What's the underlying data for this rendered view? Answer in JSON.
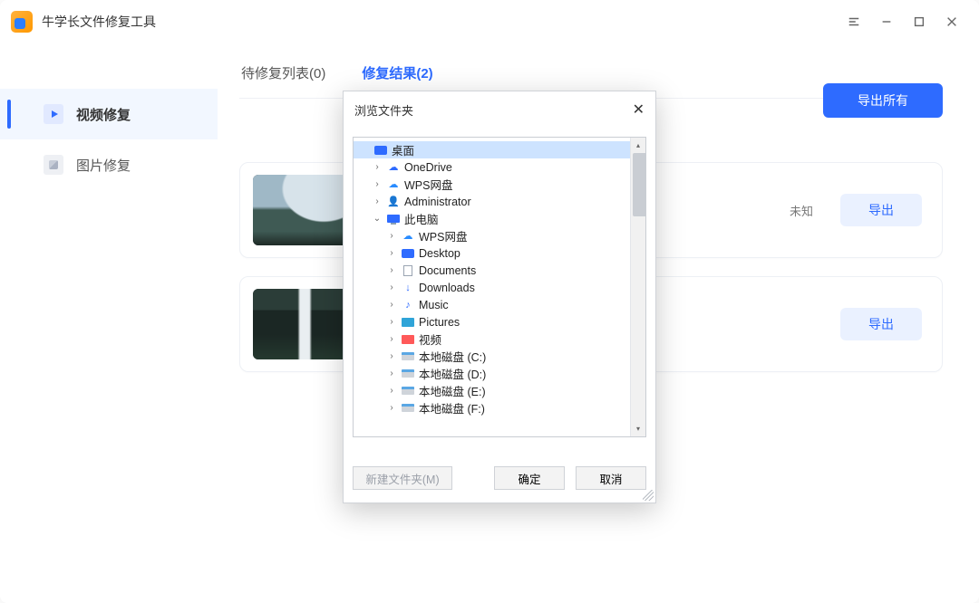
{
  "app": {
    "title": "牛学长文件修复工具"
  },
  "sidebar": {
    "items": [
      {
        "label": "视频修复"
      },
      {
        "label": "图片修复"
      }
    ]
  },
  "tabs": {
    "pending": "待修复列表(0)",
    "results": "修复结果(2)"
  },
  "buttons": {
    "export_all": "导出所有",
    "export_one": "导出"
  },
  "cards": [
    {
      "meta_visible": "未知"
    },
    {
      "meta_visible": ""
    }
  ],
  "dialog": {
    "title": "浏览文件夹",
    "new_folder": "新建文件夹(M)",
    "ok": "确定",
    "cancel": "取消",
    "tree": {
      "desktop": "桌面",
      "onedrive": "OneDrive",
      "wps": "WPS网盘",
      "admin": "Administrator",
      "thispc": "此电脑",
      "wps2": "WPS网盘",
      "desktop2": "Desktop",
      "documents": "Documents",
      "downloads": "Downloads",
      "music": "Music",
      "pictures": "Pictures",
      "videos": "视频",
      "disk_c": "本地磁盘 (C:)",
      "disk_d": "本地磁盘 (D:)",
      "disk_e": "本地磁盘 (E:)",
      "disk_f": "本地磁盘 (F:)"
    }
  }
}
